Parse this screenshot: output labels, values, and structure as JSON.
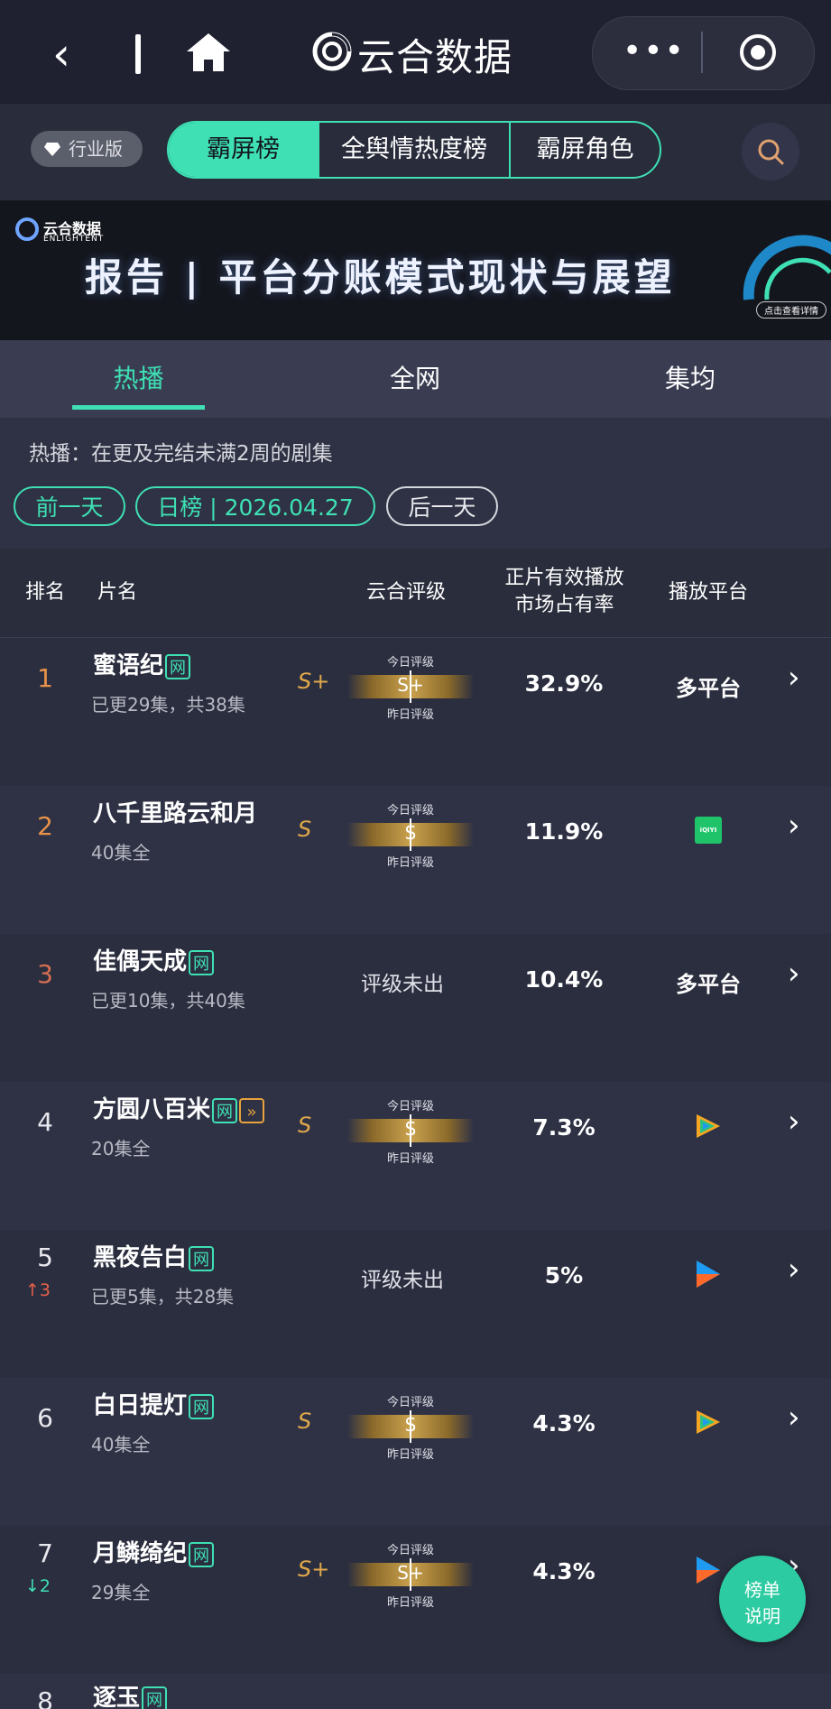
{
  "nav": {
    "title": "云合数据"
  },
  "segment": {
    "badge": "行业版",
    "tabs": [
      "霸屏榜",
      "全舆情热度榜",
      "霸屏角色"
    ],
    "active": 0
  },
  "banner": {
    "brand": "云合数据",
    "brand_sub": "ENLIGHTENT",
    "headline": "报告 | 平台分账模式现状与展望",
    "button": "点击查看详情"
  },
  "subtabs": [
    "热播",
    "全网",
    "集均"
  ],
  "note": "热播：在更及完结未满2周的剧集",
  "date": {
    "prev": "前一天",
    "current": "日榜 | 2026.04.27",
    "next": "后一天"
  },
  "table": {
    "headers": {
      "rank": "排名",
      "name": "片名",
      "grade": "云合评级",
      "share_line1": "正片有效播放",
      "share_line2": "市场占有率",
      "platform": "播放平台"
    },
    "gauge_labels": {
      "today": "今日评级",
      "yesterday": "昨日评级"
    },
    "rows": [
      {
        "rank": "1",
        "name": "蜜语纪",
        "tag": "网",
        "episodes": "已更29集，共38集",
        "grade": "S+",
        "share": "32.9%",
        "platform": "多平台"
      },
      {
        "rank": "2",
        "name": "八千里路云和月",
        "episodes": "40集全",
        "grade": "S",
        "share": "11.9%",
        "platform_icon": "iqiyi-icon",
        "platform_text": "iQIYI"
      },
      {
        "rank": "3",
        "name": "佳偶天成",
        "tag": "网",
        "episodes": "已更10集，共40集",
        "grade_text": "评级未出",
        "share": "10.4%",
        "platform": "多平台"
      },
      {
        "rank": "4",
        "name": "方圆八百米",
        "tag": "网",
        "episodes": "20集全",
        "grade": "S",
        "share": "7.3%",
        "platform_icon": "tencent-video-icon"
      },
      {
        "rank": "5",
        "change": "3",
        "change_dir": "up",
        "name": "黑夜告白",
        "tag": "网",
        "episodes": "已更5集，共28集",
        "grade_text": "评级未出",
        "share": "5%",
        "platform_icon": "youku-icon"
      },
      {
        "rank": "6",
        "name": "白日提灯",
        "tag": "网",
        "episodes": "40集全",
        "grade": "S",
        "share": "4.3%",
        "platform_icon": "tencent-video-icon"
      },
      {
        "rank": "7",
        "change": "2",
        "change_dir": "down",
        "name": "月鳞绮纪",
        "tag": "网",
        "episodes": "29集全",
        "grade": "S+",
        "share": "4.3%",
        "platform_icon": "youku-icon"
      },
      {
        "rank": "8",
        "name": "逐玉",
        "tag": "网"
      }
    ]
  },
  "help": {
    "line1": "榜单",
    "line2": "说明"
  },
  "colors": {
    "accent": "#3ee0b4",
    "gold": "#e0a84a",
    "bg": "#2a2d3c"
  }
}
